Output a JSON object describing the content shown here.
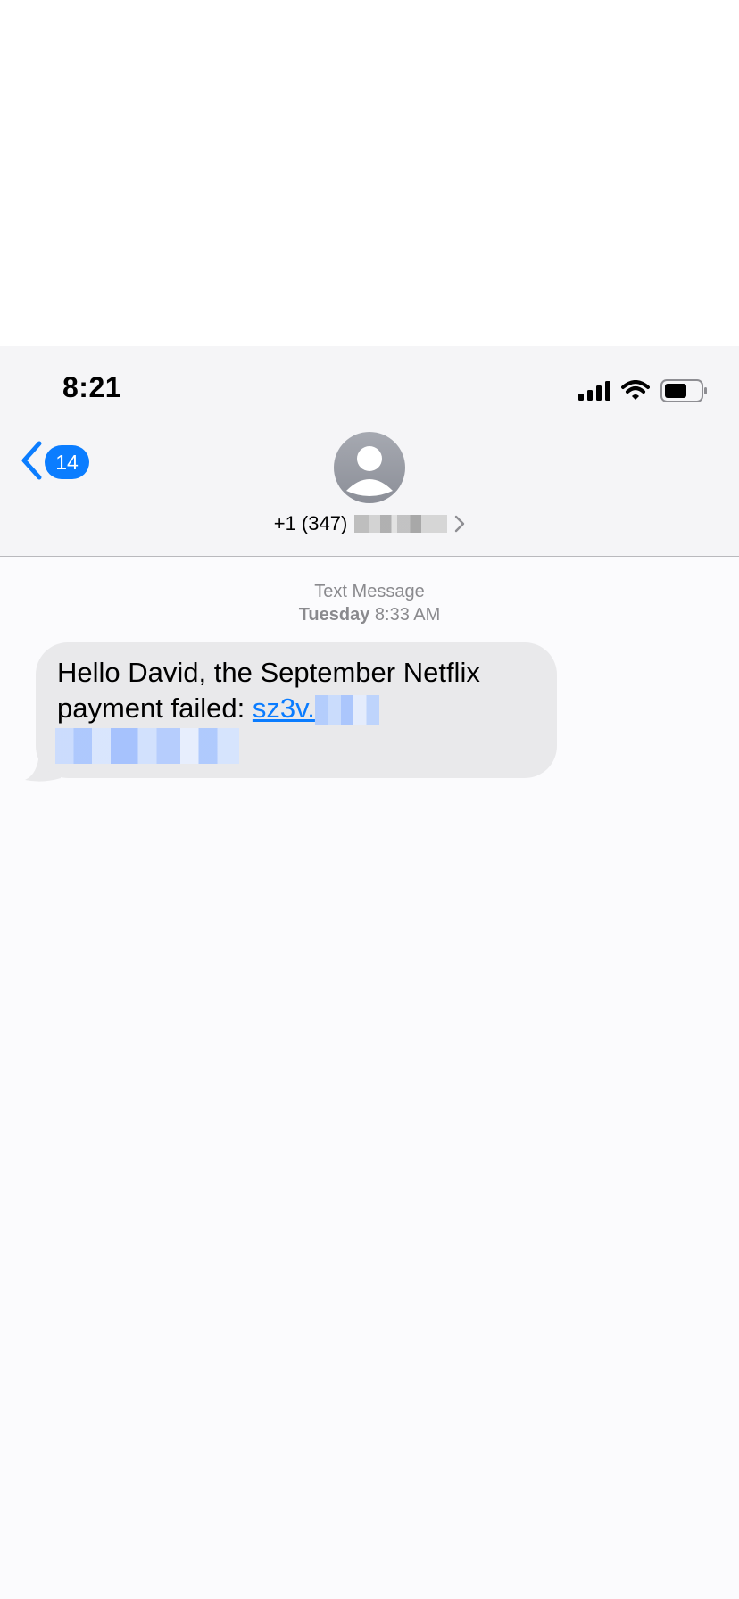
{
  "status_bar": {
    "time": "8:21"
  },
  "nav": {
    "back_count": "14",
    "contact_number": "+1 (347)",
    "icons": {
      "back": "chevron-left-icon",
      "avatar": "person-icon",
      "details": "chevron-right-icon",
      "signal": "signal-icon",
      "wifi": "wifi-icon",
      "battery": "battery-icon"
    }
  },
  "conversation": {
    "meta_type": "Text Message",
    "meta_day": "Tuesday",
    "meta_time": "8:33 AM",
    "message_text": "Hello David, the September Netflix payment failed: ",
    "message_link_prefix": "sz3v."
  },
  "colors": {
    "accent": "#0b7dff",
    "bubble": "#e9e9eb",
    "meta_text": "#8a8a8e"
  }
}
